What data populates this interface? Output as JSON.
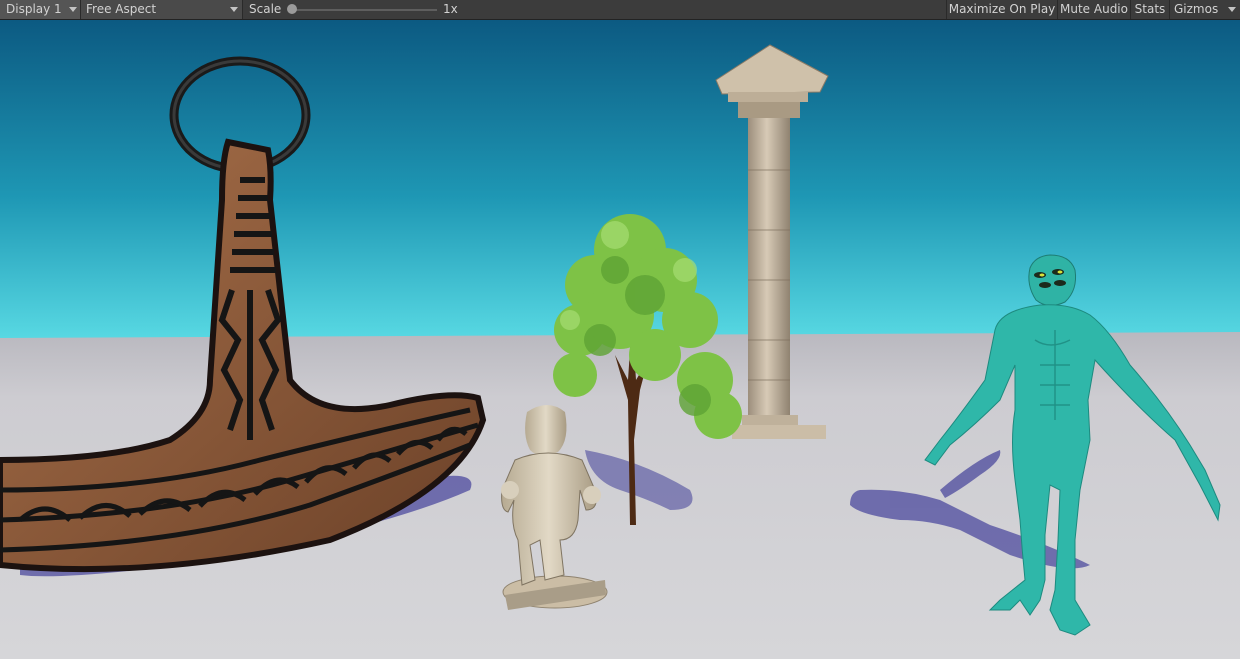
{
  "toolbar": {
    "display": "Display 1",
    "aspect": "Free Aspect",
    "scale_label": "Scale",
    "scale_value": "1x",
    "scale_level": 0.0,
    "maximize_on_play": "Maximize On Play",
    "mute_audio": "Mute Audio",
    "stats": "Stats",
    "gizmos": "Gizmos"
  },
  "scene": {
    "objects": [
      "anchor-model",
      "stone-pillar",
      "tree",
      "child-statue",
      "green-creature"
    ]
  },
  "colors": {
    "sky_top": "#0d5f86",
    "sky_horizon": "#4fd3df",
    "ground": "#c9c8cc",
    "creature": "#2fb7a9",
    "tree": "#7fc648",
    "anchor": "#8a5a3b"
  }
}
